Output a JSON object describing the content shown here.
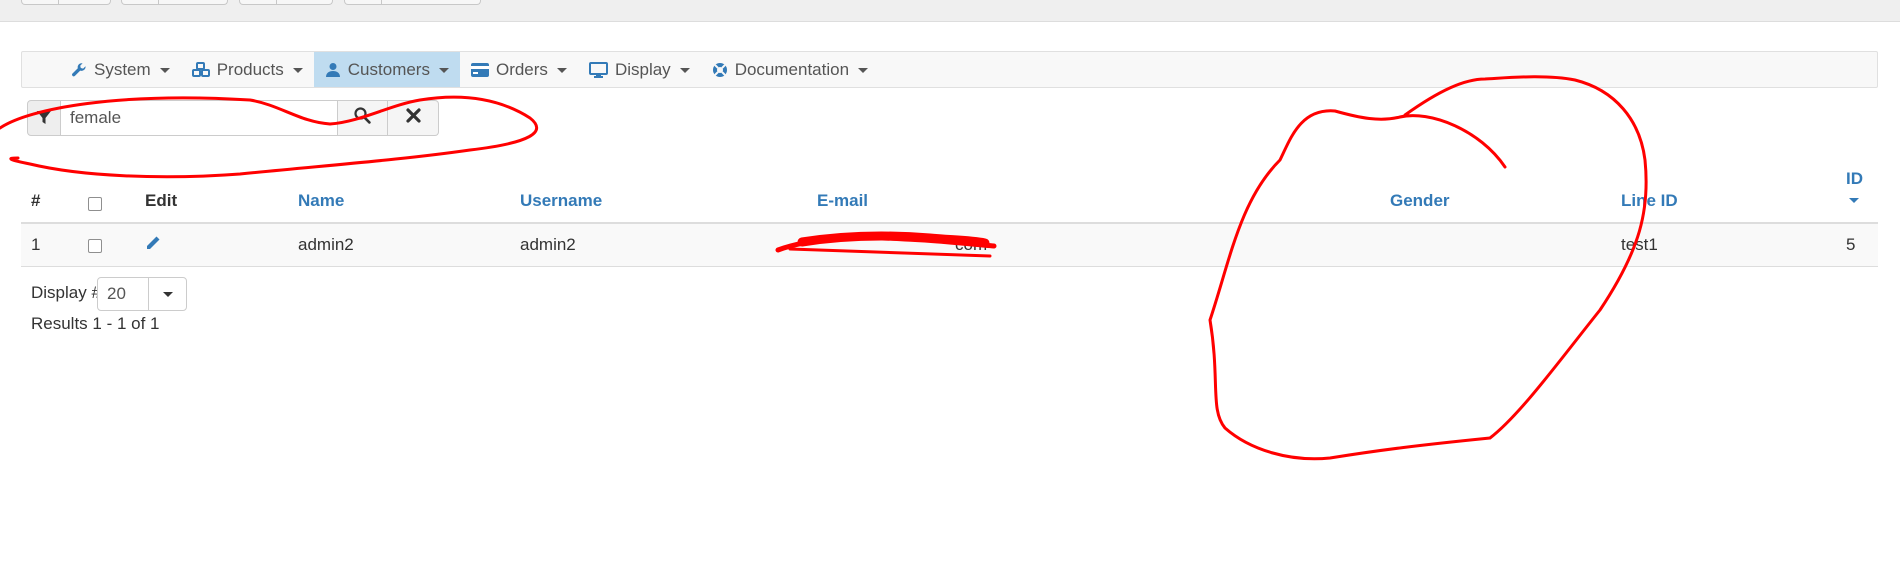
{
  "navbar": {
    "items": [
      {
        "label": "System",
        "icon": "wrench-icon",
        "active": false
      },
      {
        "label": "Products",
        "icon": "cubes-icon",
        "active": false
      },
      {
        "label": "Customers",
        "icon": "user-icon",
        "active": true
      },
      {
        "label": "Orders",
        "icon": "credit-card-icon",
        "active": false
      },
      {
        "label": "Display",
        "icon": "monitor-icon",
        "active": false
      },
      {
        "label": "Documentation",
        "icon": "lifebuoy-icon",
        "active": false
      }
    ]
  },
  "search": {
    "value": "female",
    "filter_icon": "filter-icon",
    "search_icon": "search-icon",
    "clear_icon": "close-icon"
  },
  "table": {
    "columns": {
      "index": "#",
      "edit": "Edit",
      "name": "Name",
      "username": "Username",
      "email": "E-mail",
      "gender": "Gender",
      "line_id": "Line ID",
      "id": "ID"
    },
    "rows": [
      {
        "index": "1",
        "name": "admin2",
        "username": "admin2",
        "email": "com",
        "gender": "",
        "line_id": "test1",
        "id": "5"
      }
    ]
  },
  "footer": {
    "display_label": "Display #",
    "display_value": "20",
    "results": "Results 1 - 1 of 1"
  },
  "colors": {
    "link": "#337ab7",
    "active_nav": "#bfdcf0",
    "annotation": "#ff0000"
  }
}
